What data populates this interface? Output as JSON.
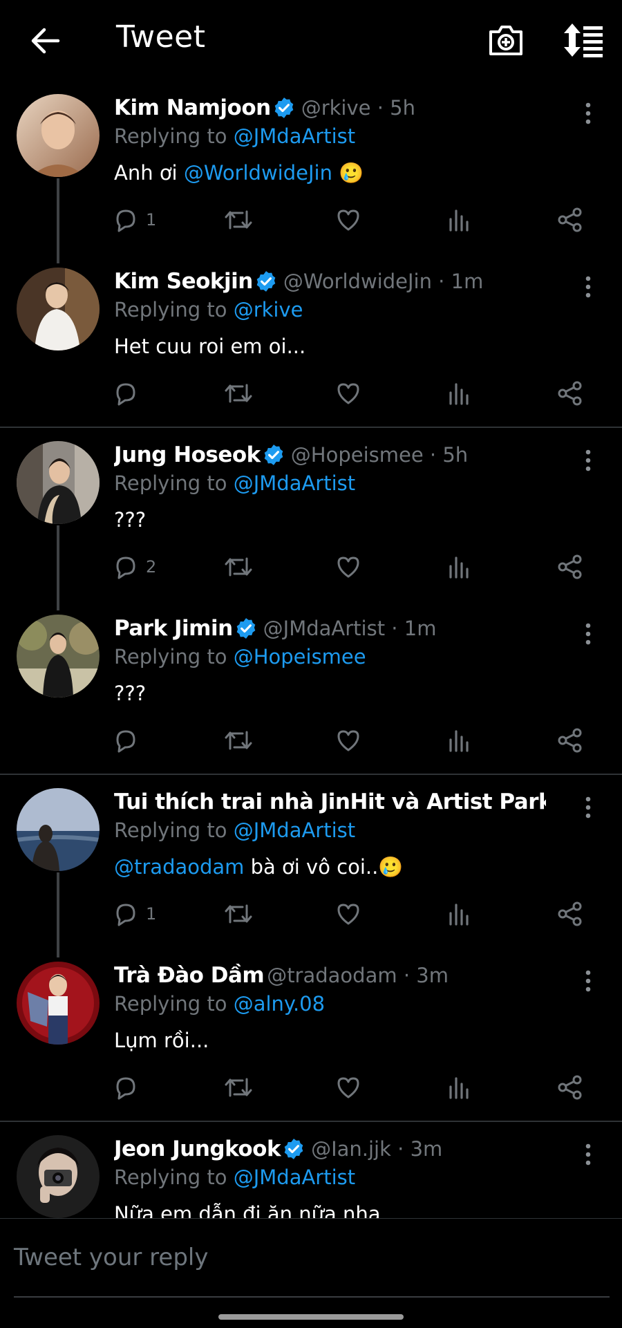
{
  "header": {
    "title": "Tweet",
    "back_icon": "arrow-left-icon",
    "camera_icon": "camera-plus-icon",
    "sort_icon": "sort-icon"
  },
  "colors": {
    "background": "#000000",
    "link": "#1d9bf0",
    "muted": "#71767b",
    "verified": "#1d9bf0"
  },
  "replying_label": "Replying to",
  "tweets": [
    {
      "name": "Kim Namjoon",
      "verified": true,
      "handle": "@rkive · 5h",
      "reply_to": "@JMdaArtist",
      "text_link": "Anh ơi",
      "text_mention": "@WorldwideJin",
      "text": "🥲",
      "reply_count": "1"
    },
    {
      "name": "Kim Seokjin",
      "verified": true,
      "handle": "@WorldwideJin · 1m",
      "reply_to": "@rkive",
      "text": "Het cuu roi em oi...",
      "reply_count": ""
    },
    {
      "name": "Jung Hoseok",
      "verified": true,
      "handle": "@Hopeismee · 5h",
      "reply_to": "@JMdaArtist",
      "text": "???",
      "reply_count": "2"
    },
    {
      "name": "Park Jimin",
      "verified": true,
      "handle": "@JMdaArtist · 1m",
      "reply_to": "@Hopeismee",
      "text": "???",
      "reply_count": ""
    },
    {
      "name": "Tui thích trai nhà JinHit và Artist Park Jimin …",
      "verified": false,
      "handle": "",
      "reply_to": "@JMdaArtist",
      "text_mention": "@tradaodam",
      "text": "bà ơi vô coi..🥲",
      "reply_count": "1"
    },
    {
      "name": "Trà Đào Dầm",
      "verified": false,
      "handle": "@tradaodam · 3m",
      "reply_to": "@alny.08",
      "text": "Lụm rồi...",
      "reply_count": ""
    },
    {
      "name": "Jeon Jungkook",
      "verified": true,
      "handle": "@Ian.jjk · 3m",
      "reply_to": "@JMdaArtist",
      "text": "Nữa em dẫn đi ăn nữa nha",
      "reply_count": ""
    }
  ],
  "compose": {
    "placeholder": "Tweet your reply"
  }
}
